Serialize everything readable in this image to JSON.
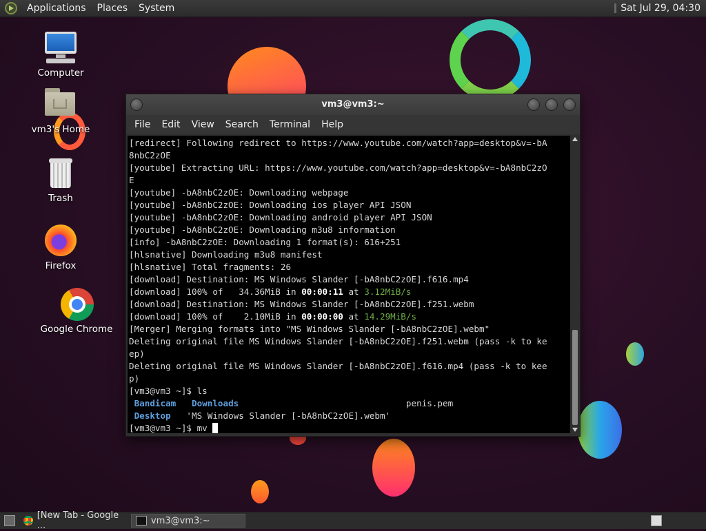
{
  "top_panel": {
    "menus": [
      "Applications",
      "Places",
      "System"
    ],
    "clock": "Sat Jul 29, 04:30"
  },
  "desktop_icons": [
    {
      "label": "Computer",
      "icon": "computer-icon"
    },
    {
      "label": "vm3's Home",
      "icon": "home-folder-icon"
    },
    {
      "label": "Trash",
      "icon": "trash-icon"
    },
    {
      "label": "Firefox",
      "icon": "firefox-icon"
    },
    {
      "label": "Google Chrome",
      "icon": "chrome-icon"
    }
  ],
  "terminal": {
    "title": "vm3@vm3:~",
    "menu": [
      "File",
      "Edit",
      "View",
      "Search",
      "Terminal",
      "Help"
    ],
    "lines": [
      "[redirect] Following redirect to https://www.youtube.com/watch?app=desktop&v=-bA",
      "8nbC2zOE",
      "[youtube] Extracting URL: https://www.youtube.com/watch?app=desktop&v=-bA8nbC2zO",
      "E",
      "[youtube] -bA8nbC2zOE: Downloading webpage",
      "[youtube] -bA8nbC2zOE: Downloading ios player API JSON",
      "[youtube] -bA8nbC2zOE: Downloading android player API JSON",
      "[youtube] -bA8nbC2zOE: Downloading m3u8 information",
      "[info] -bA8nbC2zOE: Downloading 1 format(s): 616+251",
      "[hlsnative] Downloading m3u8 manifest",
      "[hlsnative] Total fragments: 26",
      "[download] Destination: MS Windows Slander [-bA8nbC2zOE].f616.mp4"
    ],
    "dl1": {
      "prefix": "[download] 100% of   34.36MiB in ",
      "time": "00:00:11",
      "mid": " at ",
      "speed": "3.12MiB/s"
    },
    "line_dest2": "[download] Destination: MS Windows Slander [-bA8nbC2zOE].f251.webm",
    "dl2": {
      "prefix": "[download] 100% of    2.10MiB in ",
      "time": "00:00:00",
      "mid": " at ",
      "speed": "14.29MiB/s"
    },
    "lines2": [
      "[Merger] Merging formats into \"MS Windows Slander [-bA8nbC2zOE].webm\"",
      "Deleting original file MS Windows Slander [-bA8nbC2zOE].f251.webm (pass -k to ke",
      "ep)",
      "Deleting original file MS Windows Slander [-bA8nbC2zOE].f616.mp4 (pass -k to kee",
      "p)",
      "[vm3@vm3 ~]$ ls"
    ],
    "ls_dirs": [
      "Bandicam",
      "Downloads",
      "Desktop"
    ],
    "ls_files": [
      "penis.pem",
      "'MS Windows Slander [-bA8nbC2zOE].webm'"
    ],
    "prompt": "[vm3@vm3 ~]$ mv "
  },
  "taskbar": {
    "tasks": [
      {
        "label": "[New Tab - Google ...",
        "icon": "chrome-icon"
      },
      {
        "label": "vm3@vm3:~",
        "icon": "terminal-icon"
      }
    ]
  },
  "colors": {
    "accent_green": "#6fae45",
    "dir_blue": "#5f9fde"
  }
}
